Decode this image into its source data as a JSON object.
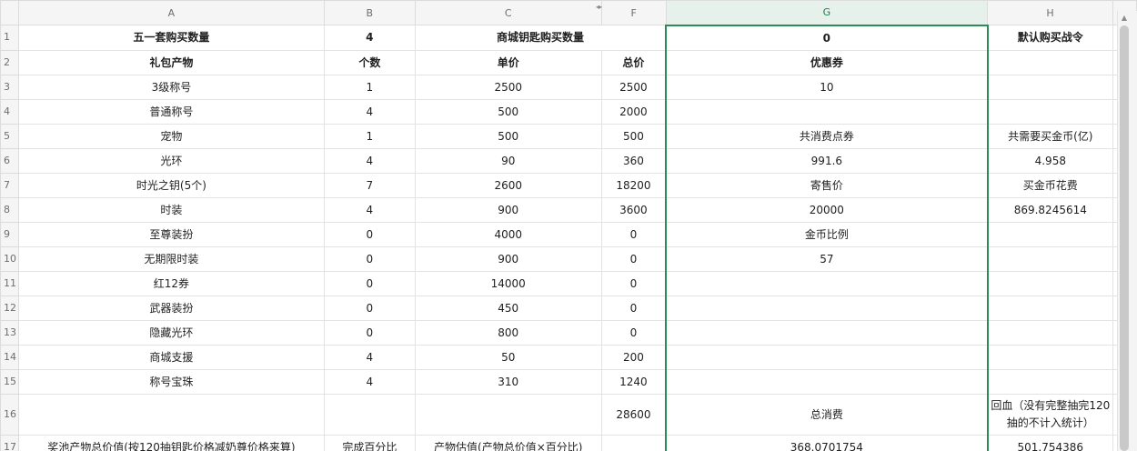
{
  "columns": [
    "A",
    "B",
    "C",
    "",
    "F",
    "G",
    "H"
  ],
  "column_controls": "◂▸",
  "row_numbers": [
    "1",
    "2",
    "3",
    "4",
    "5",
    "6",
    "7",
    "8",
    "9",
    "10",
    "11",
    "12",
    "13",
    "14",
    "15",
    "16",
    "17"
  ],
  "icons": {
    "scroll_up": "triangle-up-icon",
    "column_resize": "column-resize-icon"
  },
  "colors": {
    "selection": "#2e8b57",
    "header_bg": "#f5f5f5",
    "grid": "#e3e3e3"
  },
  "rows": [
    {
      "a": "五一套购买数量",
      "b": "4",
      "c": "商城钥匙购买数量",
      "g": "0",
      "h": "默认购买战令"
    },
    {
      "a": "礼包产物",
      "b": "个数",
      "c": "单价",
      "f": "总价",
      "g": "优惠券",
      "h": ""
    },
    {
      "a": "3级称号",
      "b": "1",
      "c": "2500",
      "f": "2500",
      "g": "10",
      "h": ""
    },
    {
      "a": "普通称号",
      "b": "4",
      "c": "500",
      "f": "2000",
      "g": "",
      "h": ""
    },
    {
      "a": "宠物",
      "b": "1",
      "c": "500",
      "f": "500",
      "g": "共消费点券",
      "h": "共需要买金币(亿)"
    },
    {
      "a": "光环",
      "b": "4",
      "c": "90",
      "f": "360",
      "g": "991.6",
      "h": "4.958"
    },
    {
      "a": "时光之钥(5个)",
      "b": "7",
      "c": "2600",
      "f": "18200",
      "g": "寄售价",
      "h": "买金币花费"
    },
    {
      "a": "时装",
      "b": "4",
      "c": "900",
      "f": "3600",
      "g": "20000",
      "h": "869.8245614"
    },
    {
      "a": "至尊装扮",
      "b": "0",
      "c": "4000",
      "f": "0",
      "g": "金币比例",
      "h": ""
    },
    {
      "a": "无期限时装",
      "b": "0",
      "c": "900",
      "f": "0",
      "g": "57",
      "h": ""
    },
    {
      "a": "红12券",
      "b": "0",
      "c": "14000",
      "f": "0",
      "g": "",
      "h": ""
    },
    {
      "a": "武器装扮",
      "b": "0",
      "c": "450",
      "f": "0",
      "g": "",
      "h": ""
    },
    {
      "a": "隐藏光环",
      "b": "0",
      "c": "800",
      "f": "0",
      "g": "",
      "h": ""
    },
    {
      "a": "商城支援",
      "b": "4",
      "c": "50",
      "f": "200",
      "g": "",
      "h": ""
    },
    {
      "a": "称号宝珠",
      "b": "4",
      "c": "310",
      "f": "1240",
      "g": "",
      "h": ""
    },
    {
      "a": "",
      "b": "",
      "c": "",
      "f": "28600",
      "g": "总消费",
      "h": "回血（没有完整抽完120抽的不计入统计）"
    },
    {
      "a": "奖池产物总价值(按120抽钥匙价格减奶尊价格来算)",
      "b": "完成百分比",
      "c": "产物估值(产物总价值×百分比)",
      "f": "",
      "g": "368.0701754",
      "h": "501.754386"
    }
  ]
}
